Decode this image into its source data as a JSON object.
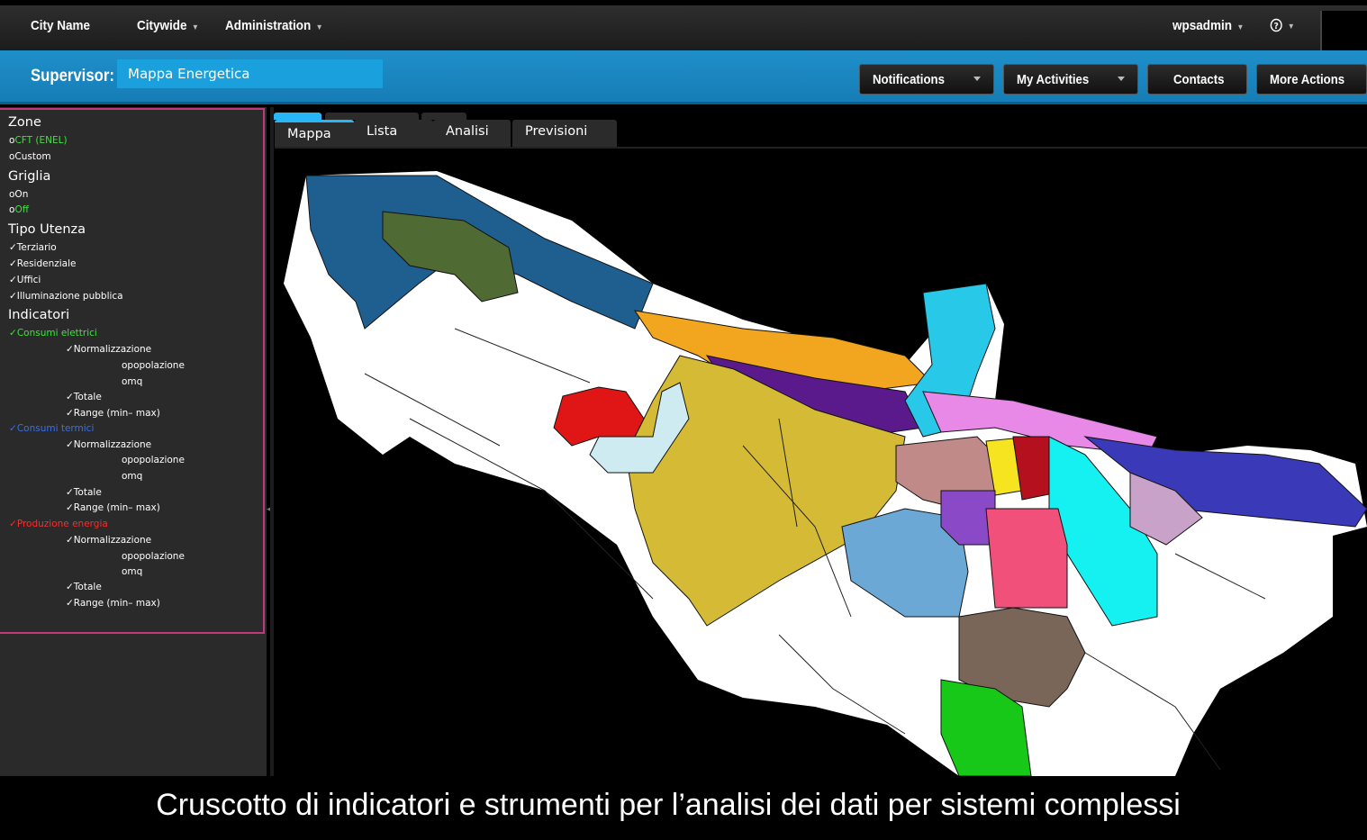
{
  "topbar": {
    "city_name": "City Name",
    "citywide": "Citywide",
    "administration": "Administration",
    "user": "wpsadmin",
    "help_icon": "help-circle-icon"
  },
  "supervisor": {
    "label": "Supervisor:",
    "value": "Mappa Energetica"
  },
  "actions": {
    "notifications": "Notifications",
    "my_activities": "My Activities",
    "contacts": "Contacts",
    "more_actions": "More Actions"
  },
  "filters": {
    "zone": {
      "title": "Zone",
      "cft_prefix": "o",
      "cft": "CFT (ENEL)",
      "custom": "oCustom"
    },
    "griglia": {
      "title": "Griglia",
      "on": "oOn",
      "off_prefix": "o",
      "off": "Off"
    },
    "tipo_utenza": {
      "title": "Tipo Utenza",
      "items": [
        "✓Terziario",
        "✓Residenziale",
        "✓Uffici",
        "✓Illuminazione pubblica"
      ]
    },
    "indicatori": {
      "title": "Indicatori",
      "check": "✓",
      "groups": [
        {
          "label": "Consumi elettrici",
          "color": "#3de33d"
        },
        {
          "label": "Consumi termici",
          "color": "#3a6fe6"
        },
        {
          "label": "Produzione energia",
          "color": "#ff2a2a"
        }
      ],
      "sub": {
        "normalizzazione": "✓Normalizzazione",
        "popolazione": "opopolazione",
        "mq": "omq",
        "totale": "✓Totale",
        "range": "✓Range (min– max)"
      }
    }
  },
  "tabs": [
    "Mappa",
    "Lista",
    "Analisi",
    "Previsioni"
  ],
  "caption": "Cruscotto di indicatori e strumenti per l’analisi dei dati per sistemi complessi",
  "colors": {
    "blue_band": "#1a8cc8",
    "accent_tab": "#29b6f6",
    "filter_border": "#c0397a",
    "green_text": "#3de33d",
    "blue_text": "#3a6fe6",
    "red_text": "#ff2a2a",
    "zones": [
      "#1f5f8f",
      "#4f6b33",
      "#f2a51f",
      "#5a1a8c",
      "#28c8e8",
      "#d5ba35",
      "#e01616",
      "#cdebf0",
      "#e889e8",
      "#3a3ab8",
      "#c08a88",
      "#f5e41f",
      "#b5101e",
      "#15f0f0",
      "#6ba8d6",
      "#8a4ac8",
      "#f0507a",
      "#c8a2c8",
      "#7a6658",
      "#18c818"
    ]
  }
}
